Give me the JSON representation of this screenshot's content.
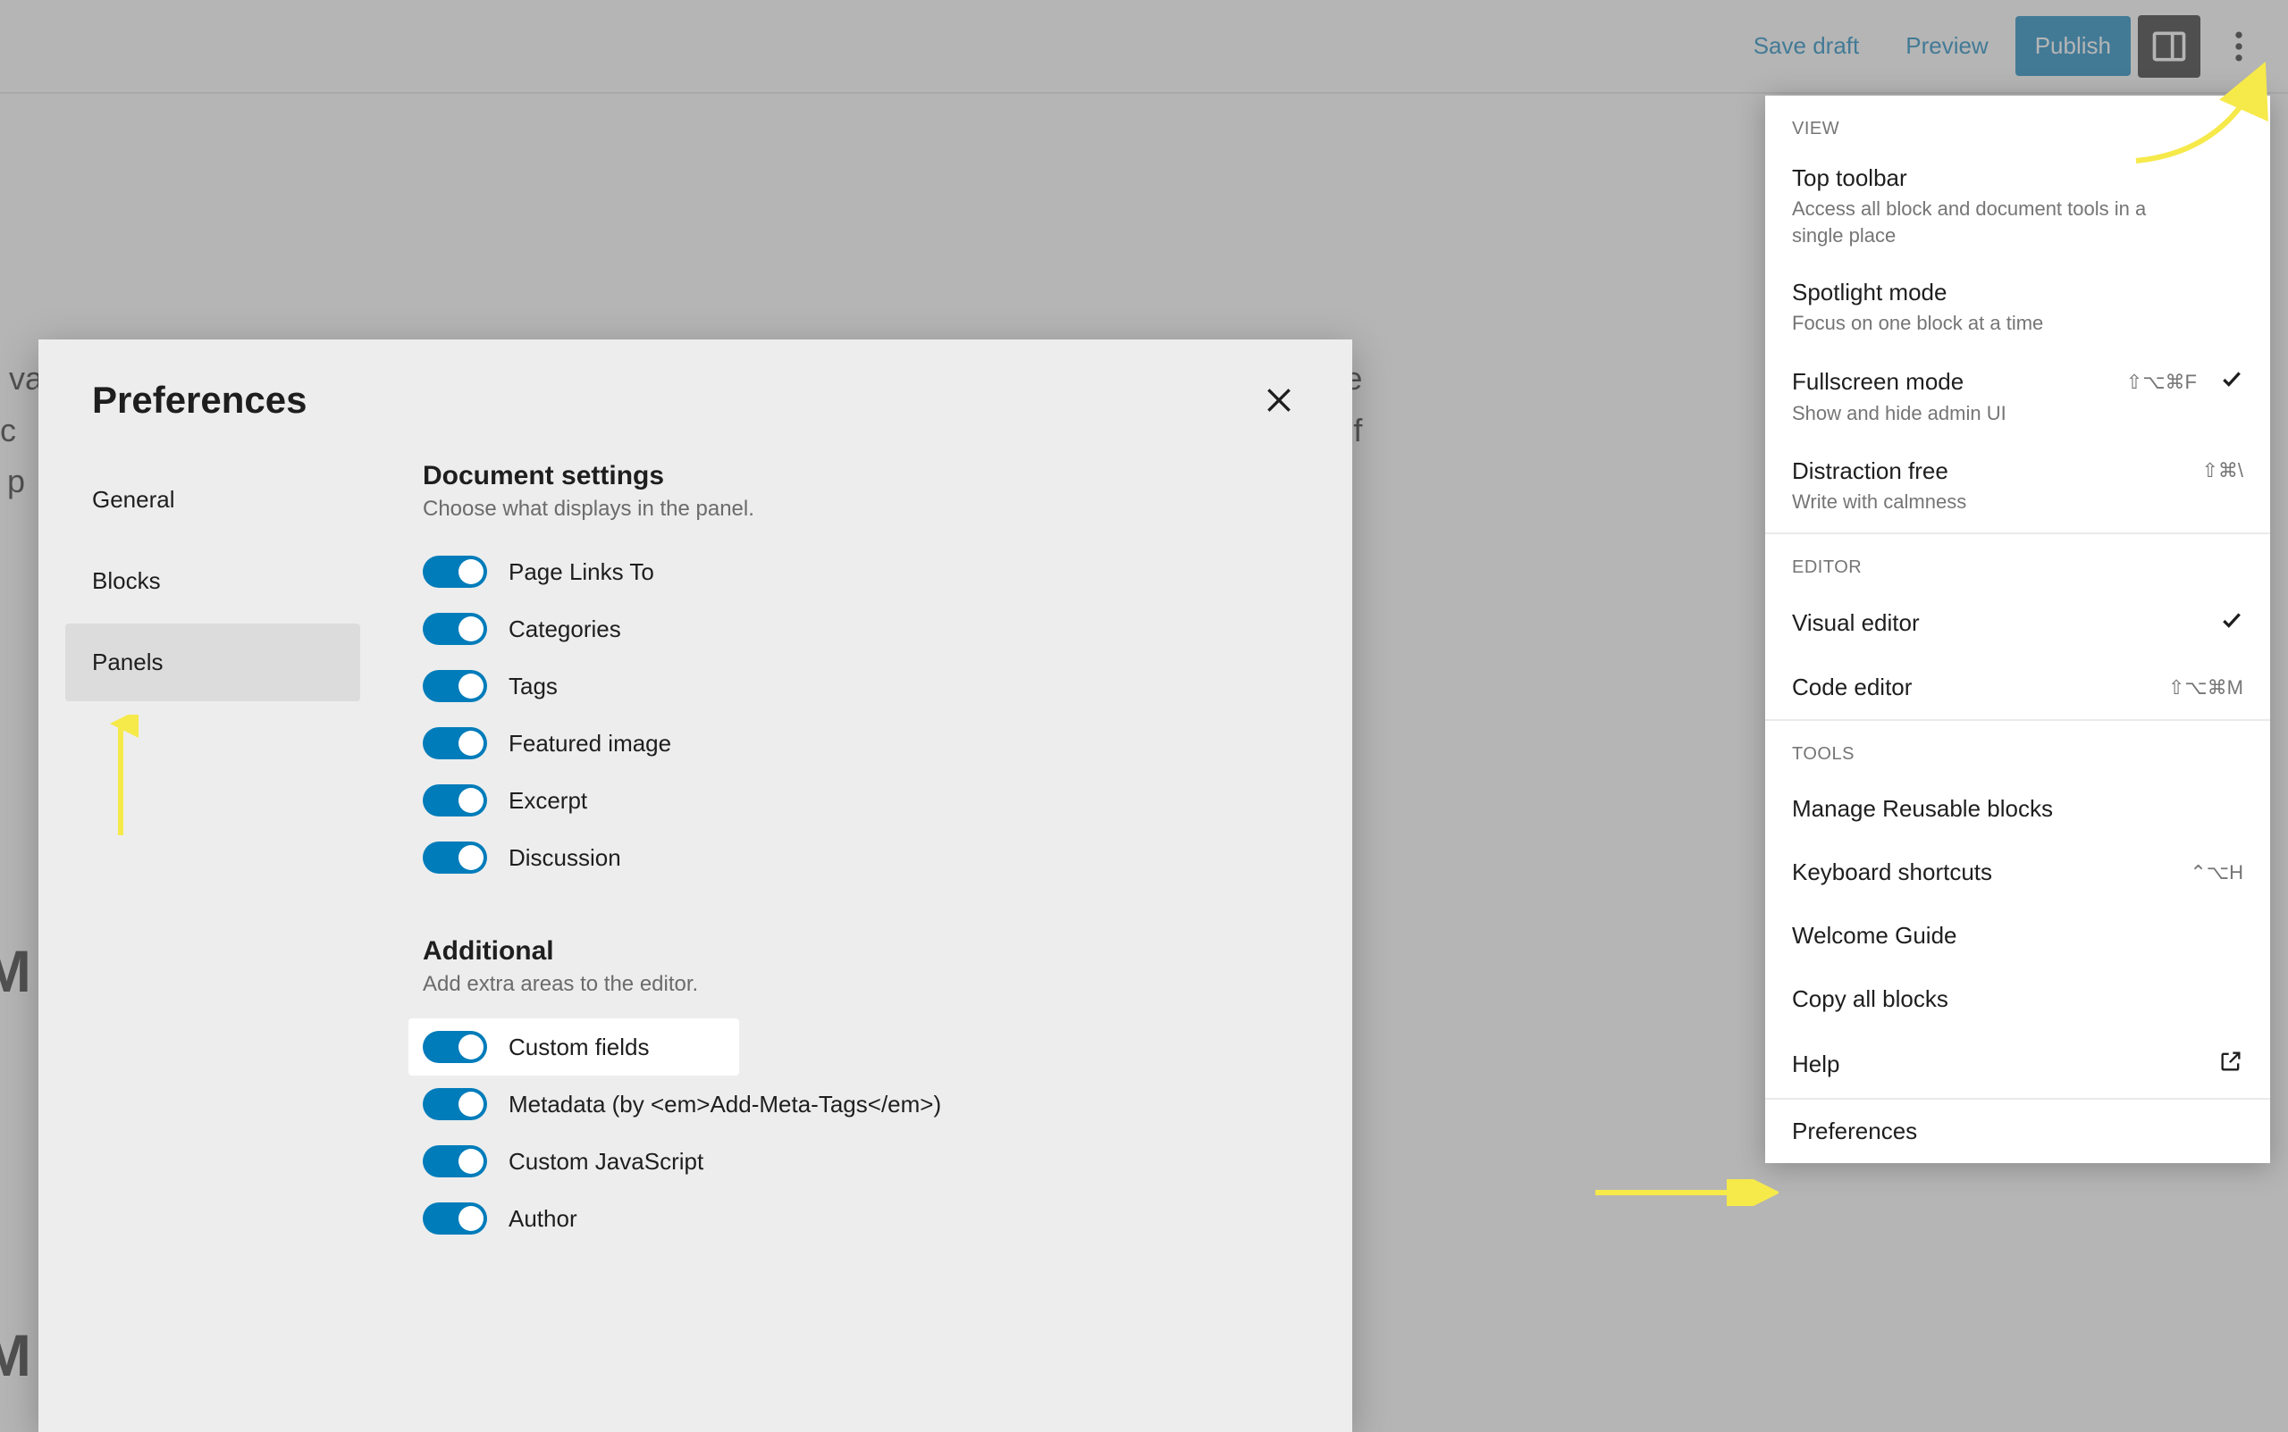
{
  "toolbar": {
    "save_draft": "Save draft",
    "preview": "Preview",
    "publish": "Publish"
  },
  "background": {
    "para": "e va                                                                                                                                        outside\nec                                                                                                                                          value of\nk p",
    "heading1": "M",
    "heading2": "M"
  },
  "options_panel": {
    "sections": {
      "view": "View",
      "editor": "Editor",
      "tools": "Tools"
    },
    "view_items": [
      {
        "title": "Top toolbar",
        "desc": "Access all block and document tools in a single place",
        "shortcut": "",
        "checked": false
      },
      {
        "title": "Spotlight mode",
        "desc": "Focus on one block at a time",
        "shortcut": "",
        "checked": false
      },
      {
        "title": "Fullscreen mode",
        "desc": "Show and hide admin UI",
        "shortcut": "⇧⌥⌘F",
        "checked": true
      },
      {
        "title": "Distraction free",
        "desc": "Write with calmness",
        "shortcut": "⇧⌘\\",
        "checked": false
      }
    ],
    "editor_items": [
      {
        "title": "Visual editor",
        "shortcut": "",
        "checked": true
      },
      {
        "title": "Code editor",
        "shortcut": "⇧⌥⌘M",
        "checked": false
      }
    ],
    "tools_items": [
      {
        "title": "Manage Reusable blocks",
        "shortcut": ""
      },
      {
        "title": "Keyboard shortcuts",
        "shortcut": "⌃⌥H"
      },
      {
        "title": "Welcome Guide",
        "shortcut": ""
      },
      {
        "title": "Copy all blocks",
        "shortcut": ""
      },
      {
        "title": "Help",
        "shortcut": "",
        "external": true
      }
    ],
    "preferences": "Preferences"
  },
  "modal": {
    "title": "Preferences",
    "tabs": [
      "General",
      "Blocks",
      "Panels"
    ],
    "active_tab": 2,
    "doc_section": {
      "heading": "Document settings",
      "sub": "Choose what displays in the panel.",
      "items": [
        "Page Links To",
        "Categories",
        "Tags",
        "Featured image",
        "Excerpt",
        "Discussion"
      ]
    },
    "additional_section": {
      "heading": "Additional",
      "sub": "Add extra areas to the editor.",
      "items": [
        "Custom fields",
        "Metadata (by <em>Add-Meta-Tags</em>)",
        "Custom JavaScript",
        "Author"
      ],
      "highlight_index": 0
    }
  }
}
